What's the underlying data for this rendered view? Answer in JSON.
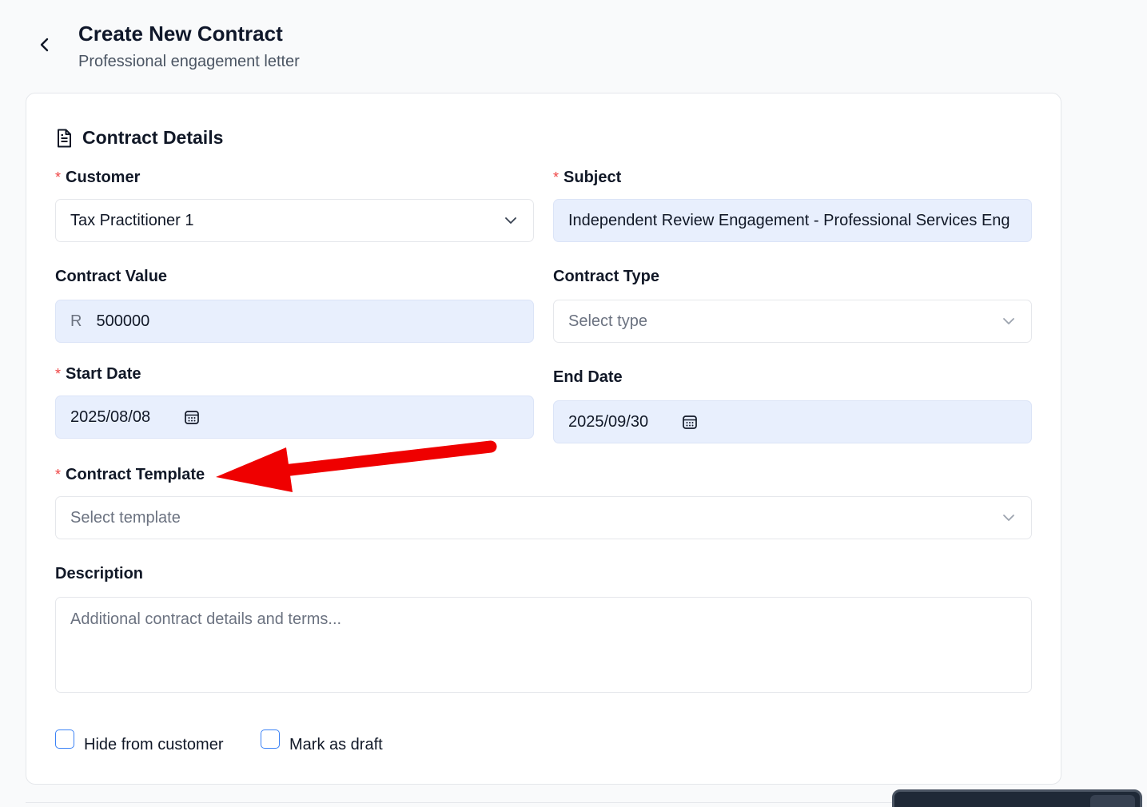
{
  "header": {
    "title": "Create New Contract",
    "subtitle": "Professional engagement letter",
    "back_icon": "chevron-left-icon"
  },
  "section": {
    "title": "Contract Details",
    "icon": "document-icon"
  },
  "fields": {
    "customer": {
      "label": "Customer",
      "required": "*",
      "value": "Tax Practitioner 1"
    },
    "subject": {
      "label": "Subject",
      "required": "*",
      "value": "Independent Review Engagement - Professional Services Eng"
    },
    "contract_value": {
      "label": "Contract Value",
      "prefix": "R",
      "value": "500000"
    },
    "contract_type": {
      "label": "Contract Type",
      "placeholder": "Select type"
    },
    "start_date": {
      "label": "Start Date",
      "required": "*",
      "value": "2025/08/08"
    },
    "end_date": {
      "label": "End Date",
      "value": "2025/09/30"
    },
    "contract_template": {
      "label": "Contract Template",
      "required": "*",
      "placeholder": "Select template"
    },
    "description": {
      "label": "Description",
      "placeholder": "Additional contract details and terms..."
    }
  },
  "checkboxes": {
    "hide_from_customer": {
      "label": "Hide from customer",
      "checked": false
    },
    "mark_as_draft": {
      "label": "Mark as draft",
      "checked": false
    }
  },
  "colors": {
    "required": "#ef4444",
    "filled_input": "#e8effd",
    "annotation_arrow": "#ef0000",
    "checkbox_border": "#3b82f6"
  }
}
